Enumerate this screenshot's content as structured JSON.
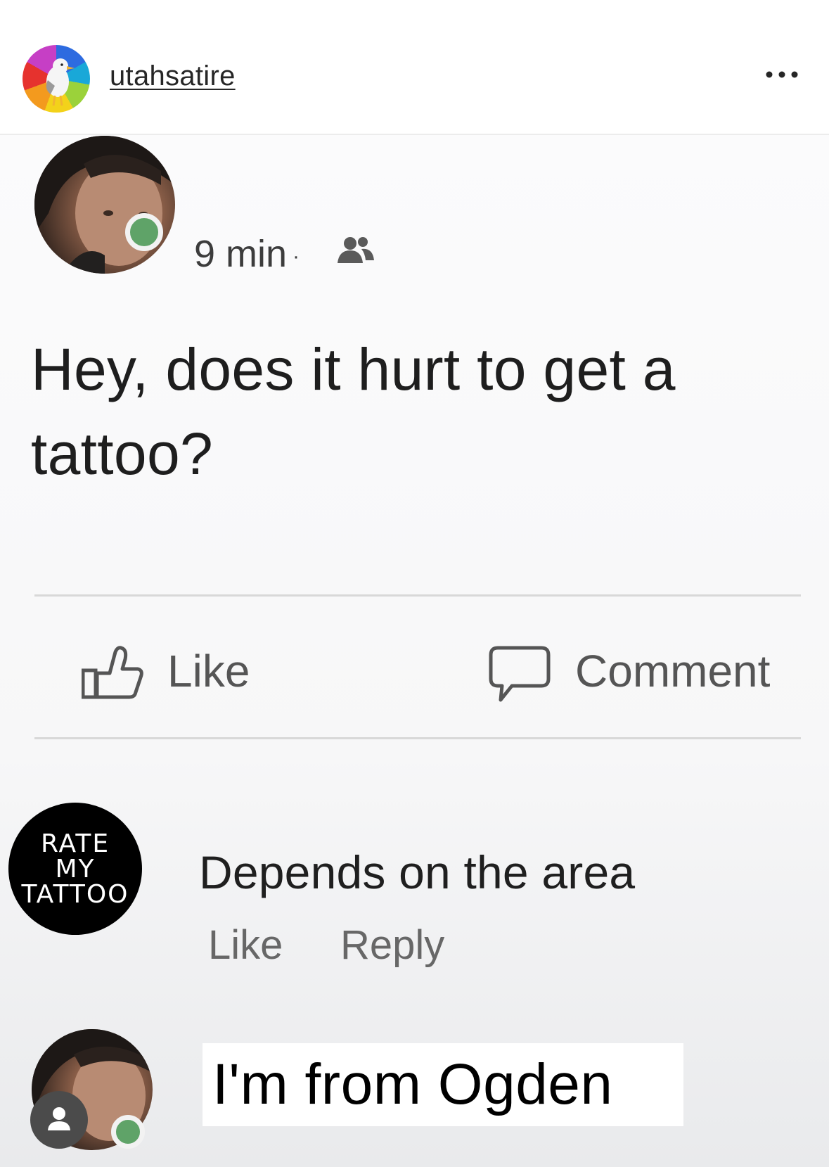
{
  "instagram_header": {
    "username": "utahsatire",
    "avatar_icon": "seagull-avatar-icon",
    "more_icon": "more-options-icon"
  },
  "post": {
    "time": "9 min",
    "separator": "·",
    "audience_icon": "friends-icon",
    "text": "Hey, does it hurt to get a tattoo?",
    "actions": {
      "like": "Like",
      "comment": "Comment"
    }
  },
  "comment": {
    "avatar_text": [
      "RATE",
      "MY",
      "TATTOO"
    ],
    "text": "Depends on the area",
    "like": "Like",
    "reply": "Reply"
  },
  "reply": {
    "text": "I'm from Ogden",
    "badge_icon": "person-icon"
  },
  "colors": {
    "online_green": "#5fa368",
    "text_dark": "#1e1e1e",
    "text_muted": "#676767"
  }
}
